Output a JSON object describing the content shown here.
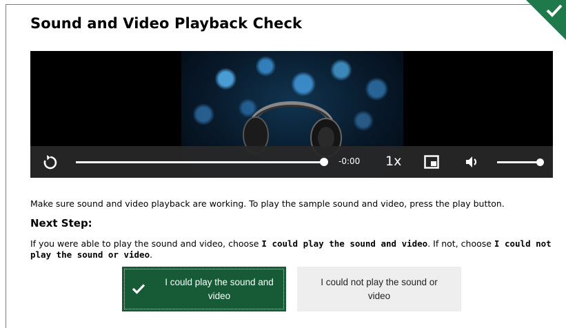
{
  "title": "Sound and Video Playback Check",
  "player": {
    "time": "-0:00",
    "rate": "1x",
    "progress": 1.0,
    "volume": 1.0
  },
  "instructions": "Make sure sound and video playback are working. To play the sample sound and video, press the play button.",
  "next_step": {
    "heading": "Next Step:",
    "text_1": "If you were able to play the sound and video, choose ",
    "bold_1": "I could play the sound and video",
    "text_2": ". If not, choose ",
    "bold_2": "I could not play the sound or video",
    "text_3": "."
  },
  "buttons": {
    "yes_label": "I could play the sound and video",
    "no_label": "I could not play the sound or video"
  },
  "colors": {
    "accent_green": "#165a36",
    "corner_green": "#1e7a4a",
    "button_gray": "#eeeeee"
  },
  "icons": [
    "replay-icon",
    "picture-in-picture-icon",
    "volume-icon",
    "checkmark-icon"
  ]
}
